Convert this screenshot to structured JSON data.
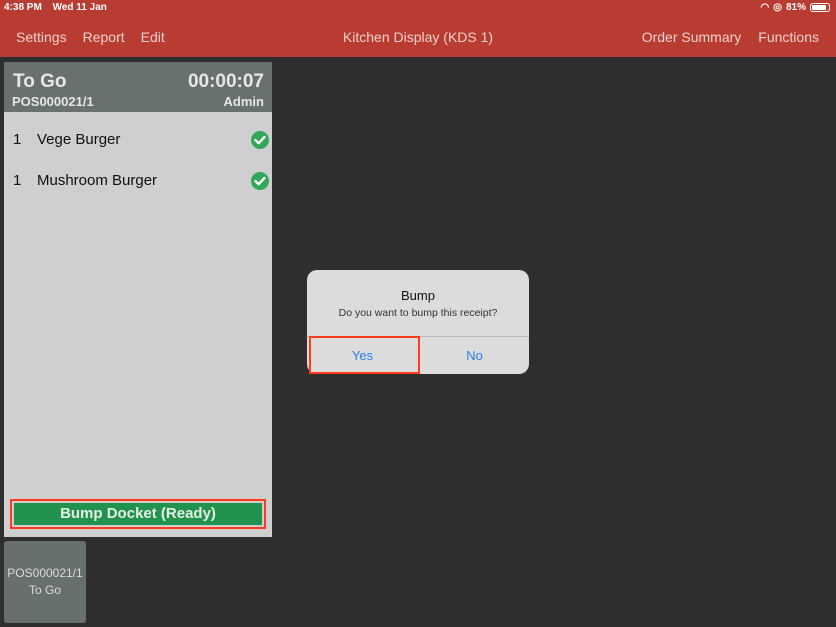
{
  "status_bar": {
    "time": "4:38 PM",
    "date": "Wed 11 Jan",
    "battery": "81%"
  },
  "nav": {
    "left": [
      "Settings",
      "Report",
      "Edit"
    ],
    "title": "Kitchen Display (KDS 1)",
    "right": [
      "Order Summary",
      "Functions"
    ]
  },
  "ticket": {
    "type": "To Go",
    "order_id": "POS000021/1",
    "timer": "00:00:07",
    "user": "Admin",
    "items": [
      {
        "qty": "1",
        "name": "Vege Burger",
        "status_icon": "check-circle-icon"
      },
      {
        "qty": "1",
        "name": "Mushroom Burger",
        "status_icon": "check-circle-icon"
      }
    ],
    "bump_label": "Bump Docket (Ready)"
  },
  "mini_ticket": {
    "order_id": "POS000021/1",
    "type": "To Go"
  },
  "dialog": {
    "title": "Bump",
    "message": "Do you want to bump this receipt?",
    "yes": "Yes",
    "no": "No"
  },
  "colors": {
    "header": "#b83c32",
    "bump_button": "#22934f",
    "highlight": "#ff3b1f",
    "dialog_button": "#2b7ff0"
  }
}
